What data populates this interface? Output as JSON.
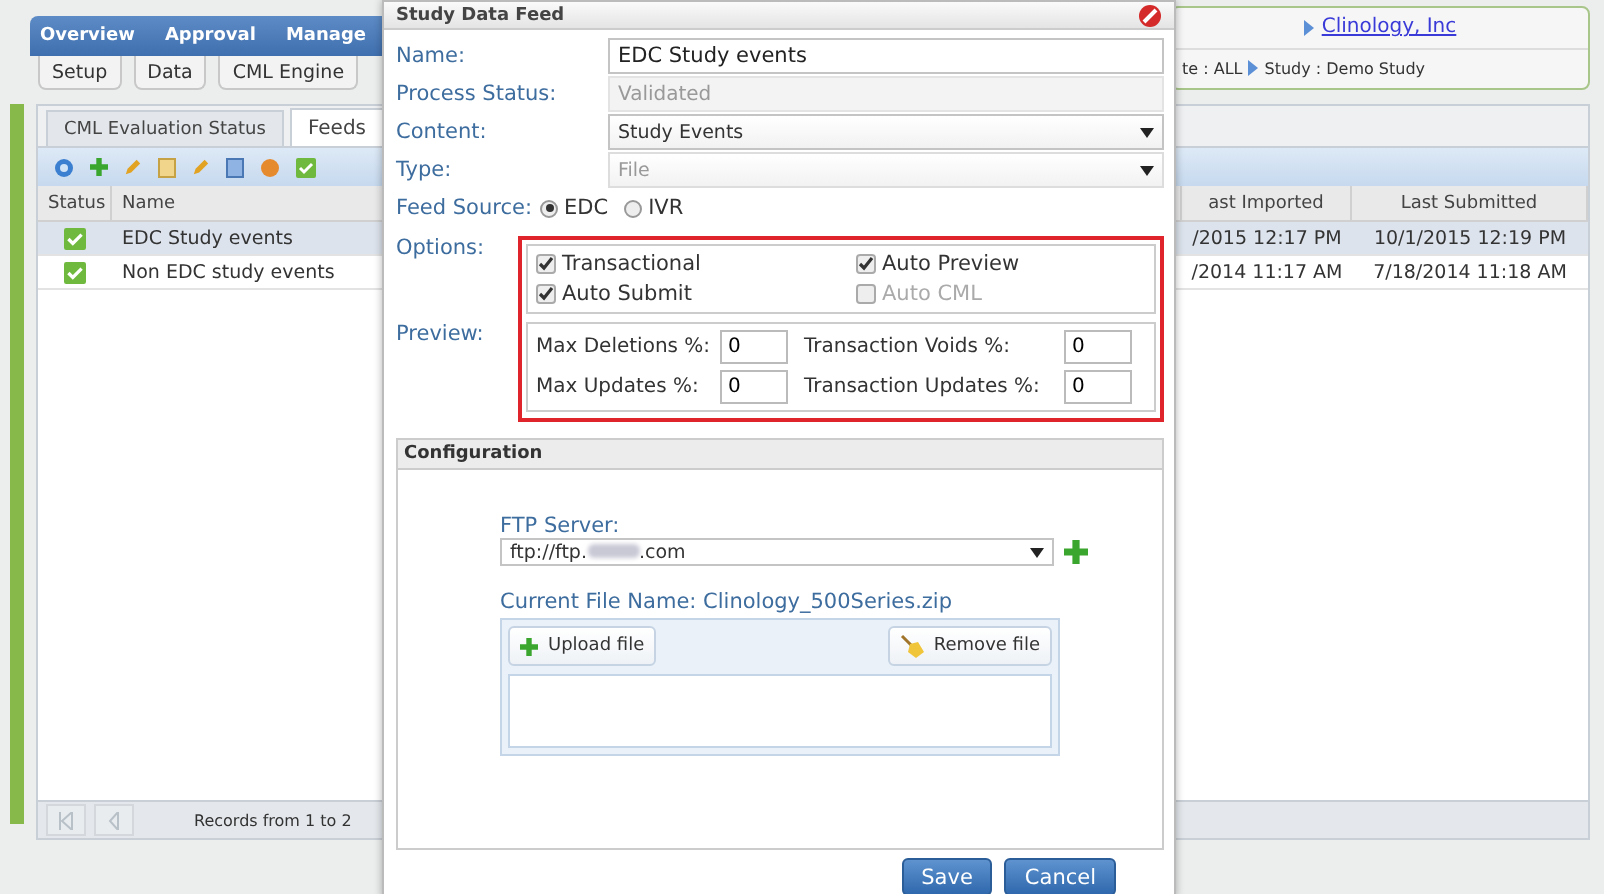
{
  "nav": {
    "items": [
      "Overview",
      "Approval",
      "Manage"
    ]
  },
  "subtabs": [
    "Setup",
    "Data",
    "CML Engine"
  ],
  "context": {
    "company": "Clinology, Inc",
    "path": [
      "te : ALL",
      "Study : Demo Study"
    ]
  },
  "tabs": [
    {
      "label": "CML Evaluation Status",
      "selected": false
    },
    {
      "label": "Feeds",
      "selected": true
    }
  ],
  "table": {
    "columns": [
      "Status",
      "Name",
      "ast Imported",
      "Last Submitted"
    ],
    "rows": [
      {
        "ok": true,
        "name": "EDC Study events",
        "last_imported": "/2015 12:17 PM",
        "last_submitted": "10/1/2015 12:19 PM",
        "selected": true
      },
      {
        "ok": true,
        "name": "Non EDC study events",
        "last_imported": "/2014 11:17 AM",
        "last_submitted": "7/18/2014 11:18 AM",
        "selected": false
      }
    ]
  },
  "pager": {
    "text": "Records from 1 to 2"
  },
  "dialog": {
    "title": "Study Data Feed",
    "name": {
      "label": "Name:",
      "value": "EDC Study events"
    },
    "process_status": {
      "label": "Process Status:",
      "value": "Validated"
    },
    "content": {
      "label": "Content:",
      "value": "Study Events",
      "disabled": false
    },
    "type": {
      "label": "Type:",
      "value": "File",
      "disabled": true
    },
    "feed_source": {
      "label": "Feed Source:",
      "options": [
        {
          "label": "EDC",
          "selected": true
        },
        {
          "label": "IVR",
          "selected": false
        }
      ]
    },
    "options": {
      "label": "Options:",
      "items": [
        {
          "label": "Transactional",
          "checked": true,
          "disabled": false
        },
        {
          "label": "Auto Preview",
          "checked": true,
          "disabled": false
        },
        {
          "label": "Auto Submit",
          "checked": true,
          "disabled": false
        },
        {
          "label": "Auto CML",
          "checked": false,
          "disabled": true
        }
      ]
    },
    "preview": {
      "label": "Preview:",
      "fields": [
        {
          "label": "Max Deletions %:",
          "value": "0"
        },
        {
          "label": "Transaction Voids %:",
          "value": "0"
        },
        {
          "label": "Max Updates %:",
          "value": "0"
        },
        {
          "label": "Transaction Updates %:",
          "value": "0"
        }
      ]
    },
    "configuration": {
      "title": "Configuration",
      "ftp_label": "FTP Server:",
      "ftp_prefix": "ftp://ftp.",
      "ftp_suffix": ".com",
      "file_name": "Current File Name: Clinology_500Series.zip",
      "upload": "Upload file",
      "remove": "Remove file"
    },
    "buttons": [
      "Save",
      "Cancel"
    ]
  }
}
